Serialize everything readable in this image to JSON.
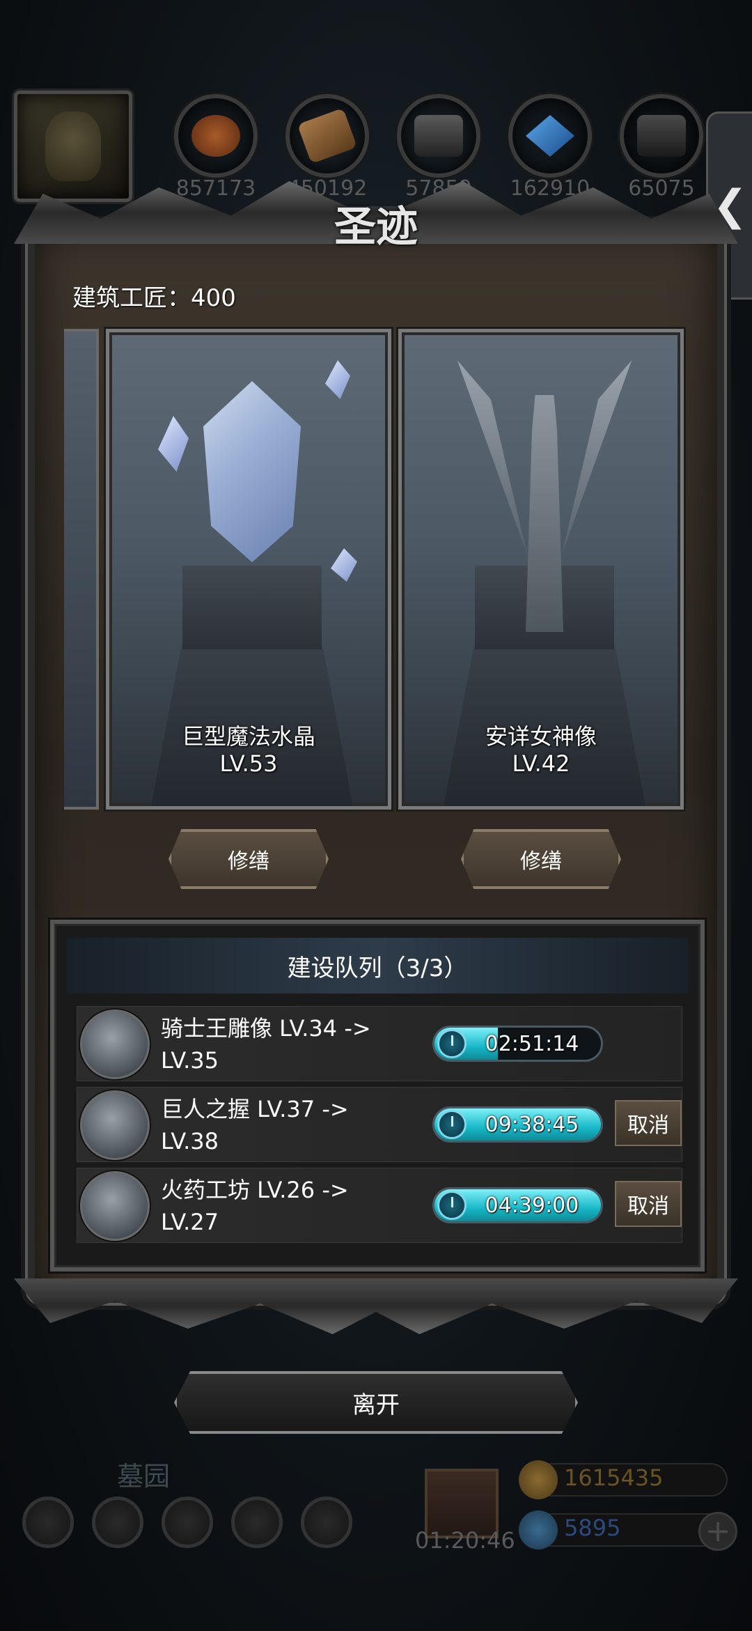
{
  "resources": [
    {
      "icon": "food-icon",
      "value": "857173",
      "color": "#7a3a1a"
    },
    {
      "icon": "wood-icon",
      "value": "450192",
      "color": "#6a4a2a"
    },
    {
      "icon": "stone-icon",
      "value": "57859",
      "color": "#3a3a3a"
    },
    {
      "icon": "crystal-icon",
      "value": "162910",
      "color": "#1a4a7a"
    },
    {
      "icon": "iron-icon",
      "value": "65075",
      "color": "#3a3a3a"
    }
  ],
  "side_tab": {
    "label": "❮"
  },
  "panel": {
    "title": "圣迹",
    "craftsman": "建筑工匠：400"
  },
  "buildings": [
    {
      "name": "巨型魔法水晶",
      "level": "LV.53",
      "action": "修缮"
    },
    {
      "name": "安详女神像",
      "level": "LV.42",
      "action": "修缮"
    }
  ],
  "queue": {
    "title": "建设队列（3/3）",
    "rows": [
      {
        "text": "骑士王雕像 LV.34 -> LV.35",
        "timer": "02:51:14",
        "progress": 0.38,
        "cancel": ""
      },
      {
        "text": "巨人之握 LV.37 -> LV.38",
        "timer": "09:38:45",
        "progress": 1.0,
        "cancel": "取消"
      },
      {
        "text": "火药工坊 LV.26 -> LV.27",
        "timer": "04:39:00",
        "progress": 1.0,
        "cancel": "取消"
      }
    ]
  },
  "leave_label": "离开",
  "bottom": {
    "location": "墓园",
    "gift_timer": "01:20:46",
    "gold": "1615435",
    "gems": "5895",
    "plus": "+"
  },
  "colors": {
    "accent_cyan": "#18b8c8",
    "panel_brown": "#2e2822",
    "gold_dim": "#6a5424",
    "blue_dim": "#2a4a80"
  }
}
